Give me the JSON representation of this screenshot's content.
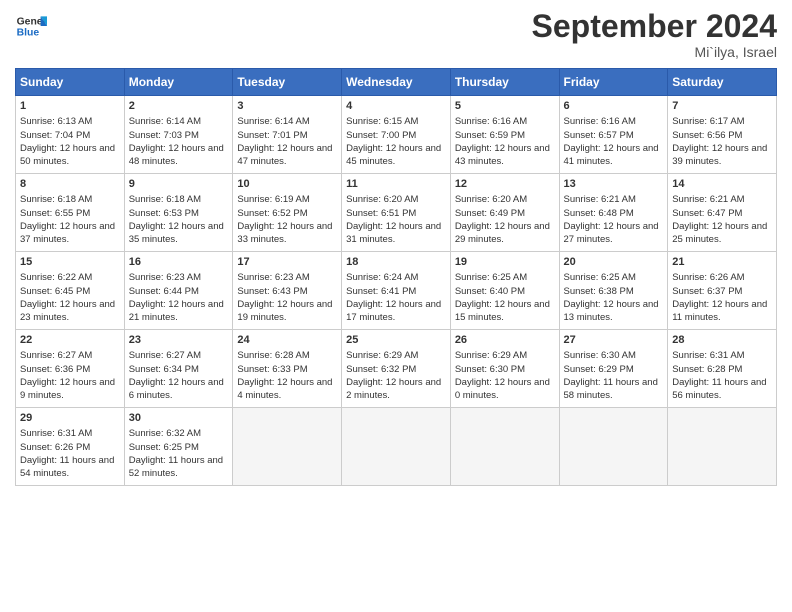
{
  "logo": {
    "line1": "General",
    "line2": "Blue"
  },
  "title": "September 2024",
  "location": "Mi`ilya, Israel",
  "days_header": [
    "Sunday",
    "Monday",
    "Tuesday",
    "Wednesday",
    "Thursday",
    "Friday",
    "Saturday"
  ],
  "weeks": [
    [
      {
        "day": 1,
        "sunrise": "6:13 AM",
        "sunset": "7:04 PM",
        "daylight": "12 hours and 50 minutes."
      },
      {
        "day": 2,
        "sunrise": "6:14 AM",
        "sunset": "7:03 PM",
        "daylight": "12 hours and 48 minutes."
      },
      {
        "day": 3,
        "sunrise": "6:14 AM",
        "sunset": "7:01 PM",
        "daylight": "12 hours and 47 minutes."
      },
      {
        "day": 4,
        "sunrise": "6:15 AM",
        "sunset": "7:00 PM",
        "daylight": "12 hours and 45 minutes."
      },
      {
        "day": 5,
        "sunrise": "6:16 AM",
        "sunset": "6:59 PM",
        "daylight": "12 hours and 43 minutes."
      },
      {
        "day": 6,
        "sunrise": "6:16 AM",
        "sunset": "6:57 PM",
        "daylight": "12 hours and 41 minutes."
      },
      {
        "day": 7,
        "sunrise": "6:17 AM",
        "sunset": "6:56 PM",
        "daylight": "12 hours and 39 minutes."
      }
    ],
    [
      {
        "day": 8,
        "sunrise": "6:18 AM",
        "sunset": "6:55 PM",
        "daylight": "12 hours and 37 minutes."
      },
      {
        "day": 9,
        "sunrise": "6:18 AM",
        "sunset": "6:53 PM",
        "daylight": "12 hours and 35 minutes."
      },
      {
        "day": 10,
        "sunrise": "6:19 AM",
        "sunset": "6:52 PM",
        "daylight": "12 hours and 33 minutes."
      },
      {
        "day": 11,
        "sunrise": "6:20 AM",
        "sunset": "6:51 PM",
        "daylight": "12 hours and 31 minutes."
      },
      {
        "day": 12,
        "sunrise": "6:20 AM",
        "sunset": "6:49 PM",
        "daylight": "12 hours and 29 minutes."
      },
      {
        "day": 13,
        "sunrise": "6:21 AM",
        "sunset": "6:48 PM",
        "daylight": "12 hours and 27 minutes."
      },
      {
        "day": 14,
        "sunrise": "6:21 AM",
        "sunset": "6:47 PM",
        "daylight": "12 hours and 25 minutes."
      }
    ],
    [
      {
        "day": 15,
        "sunrise": "6:22 AM",
        "sunset": "6:45 PM",
        "daylight": "12 hours and 23 minutes."
      },
      {
        "day": 16,
        "sunrise": "6:23 AM",
        "sunset": "6:44 PM",
        "daylight": "12 hours and 21 minutes."
      },
      {
        "day": 17,
        "sunrise": "6:23 AM",
        "sunset": "6:43 PM",
        "daylight": "12 hours and 19 minutes."
      },
      {
        "day": 18,
        "sunrise": "6:24 AM",
        "sunset": "6:41 PM",
        "daylight": "12 hours and 17 minutes."
      },
      {
        "day": 19,
        "sunrise": "6:25 AM",
        "sunset": "6:40 PM",
        "daylight": "12 hours and 15 minutes."
      },
      {
        "day": 20,
        "sunrise": "6:25 AM",
        "sunset": "6:38 PM",
        "daylight": "12 hours and 13 minutes."
      },
      {
        "day": 21,
        "sunrise": "6:26 AM",
        "sunset": "6:37 PM",
        "daylight": "12 hours and 11 minutes."
      }
    ],
    [
      {
        "day": 22,
        "sunrise": "6:27 AM",
        "sunset": "6:36 PM",
        "daylight": "12 hours and 9 minutes."
      },
      {
        "day": 23,
        "sunrise": "6:27 AM",
        "sunset": "6:34 PM",
        "daylight": "12 hours and 6 minutes."
      },
      {
        "day": 24,
        "sunrise": "6:28 AM",
        "sunset": "6:33 PM",
        "daylight": "12 hours and 4 minutes."
      },
      {
        "day": 25,
        "sunrise": "6:29 AM",
        "sunset": "6:32 PM",
        "daylight": "12 hours and 2 minutes."
      },
      {
        "day": 26,
        "sunrise": "6:29 AM",
        "sunset": "6:30 PM",
        "daylight": "12 hours and 0 minutes."
      },
      {
        "day": 27,
        "sunrise": "6:30 AM",
        "sunset": "6:29 PM",
        "daylight": "11 hours and 58 minutes."
      },
      {
        "day": 28,
        "sunrise": "6:31 AM",
        "sunset": "6:28 PM",
        "daylight": "11 hours and 56 minutes."
      }
    ],
    [
      {
        "day": 29,
        "sunrise": "6:31 AM",
        "sunset": "6:26 PM",
        "daylight": "11 hours and 54 minutes."
      },
      {
        "day": 30,
        "sunrise": "6:32 AM",
        "sunset": "6:25 PM",
        "daylight": "11 hours and 52 minutes."
      },
      null,
      null,
      null,
      null,
      null
    ]
  ]
}
